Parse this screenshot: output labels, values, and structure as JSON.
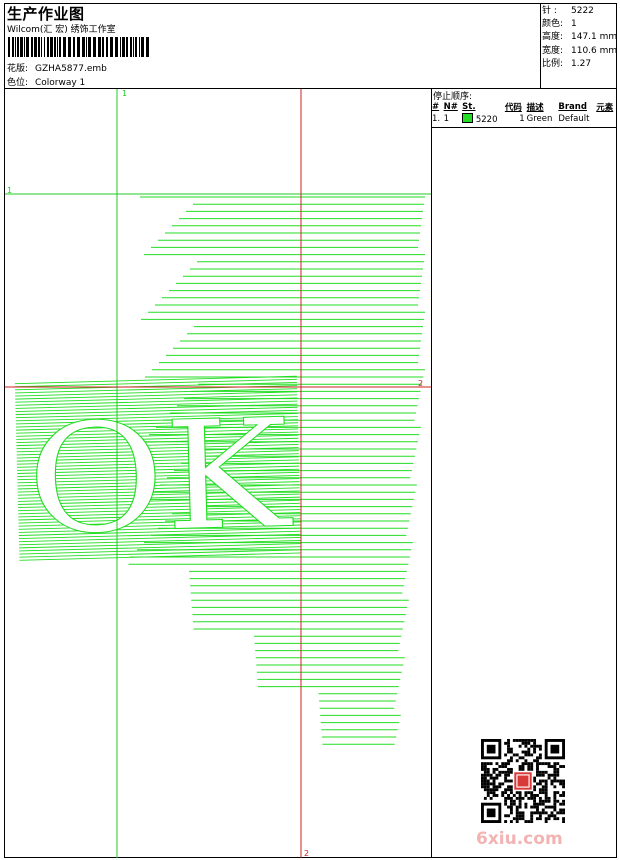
{
  "header": {
    "title": "生产作业图",
    "subtitle": "Wilcom(汇 宏) 绣饰工作室",
    "design_label": "花版:",
    "design_value": "GZHA5877.emb",
    "colorway_label": "色位:",
    "colorway_value": "Colorway 1"
  },
  "stats": [
    {
      "label": "针 :",
      "value": "5222"
    },
    {
      "label": "颜色:",
      "value": "1"
    },
    {
      "label": "高度:",
      "value": "147.1 mm"
    },
    {
      "label": "宽度:",
      "value": "110.6 mm"
    },
    {
      "label": "比例:",
      "value": "1.27"
    }
  ],
  "stop_sequence": {
    "title": "停止顺序:",
    "headers": [
      "#",
      "N#",
      "St.",
      "代码",
      "描述",
      "Brand",
      "元素"
    ],
    "rows": [
      {
        "index": "1.",
        "needle": "1",
        "stitches": "5220",
        "code": "1",
        "description": "Green",
        "brand": "Default",
        "element": "",
        "swatch_color": "#22dd22"
      }
    ]
  },
  "guides": {
    "vertical_green": "1",
    "horizontal_green": "1",
    "vertical_red": "2",
    "horizontal_red": "2"
  },
  "design": {
    "text": "OK",
    "stitch_color": "#22dd22",
    "guide_green": "#22cc22",
    "guide_red": "#cc2222"
  },
  "watermark": "6xiu.com"
}
